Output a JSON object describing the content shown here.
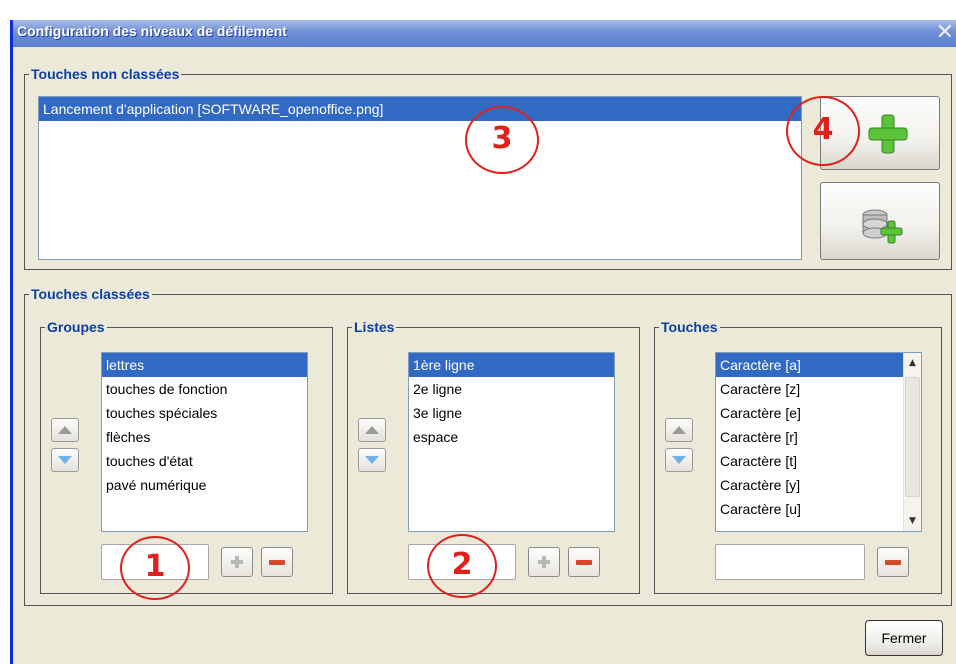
{
  "window": {
    "title": "Configuration des niveaux de défilement",
    "close_glyph": "✕"
  },
  "unclassified": {
    "legend": "Touches non classées",
    "items": [
      "Lancement d'application [SOFTWARE_openoffice.png]"
    ],
    "add_button_icon": "green-plus-icon",
    "add_db_button_icon": "database-add-icon"
  },
  "classified": {
    "legend": "Touches classées",
    "groups": {
      "legend": "Groupes",
      "items": [
        "lettres",
        "touches de fonction",
        "touches spéciales",
        "flèches",
        "touches d'état",
        "pavé numérique"
      ],
      "selected_index": 0,
      "input_value": ""
    },
    "lists": {
      "legend": "Listes",
      "items": [
        "1ère ligne",
        "2e ligne",
        "3e ligne",
        "espace"
      ],
      "selected_index": 0,
      "input_value": ""
    },
    "keys": {
      "legend": "Touches",
      "items": [
        "Caractère [a]",
        "Caractère [z]",
        "Caractère [e]",
        "Caractère [r]",
        "Caractère [t]",
        "Caractère [y]",
        "Caractère [u]"
      ],
      "selected_index": 0,
      "input_value": ""
    }
  },
  "footer": {
    "close_label": "Fermer"
  },
  "annotations": [
    "1",
    "2",
    "3",
    "4"
  ],
  "colors": {
    "accent": "#316ac5",
    "legend": "#0a3fa8",
    "annotation": "#e0201b"
  }
}
